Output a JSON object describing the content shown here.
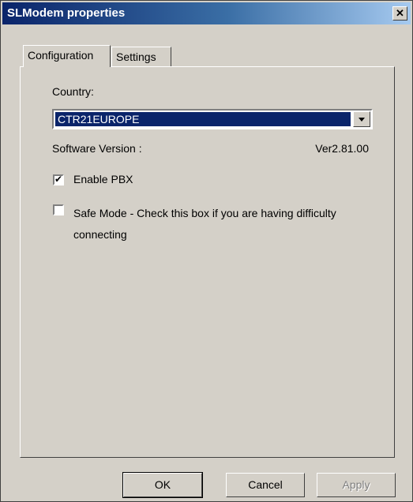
{
  "window": {
    "title": "SLModem properties",
    "close_glyph": "✕"
  },
  "tabs": [
    {
      "label": "Configuration",
      "active": true
    },
    {
      "label": "Settings",
      "active": false
    }
  ],
  "configuration": {
    "country_label": "Country:",
    "country_value": "CTR21EUROPE",
    "software_version_label": "Software Version :",
    "software_version_value": "Ver2.81.00",
    "enable_pbx": {
      "label": "Enable PBX",
      "checked": true
    },
    "safe_mode": {
      "label": "Safe Mode - Check this box if you are having difficulty connecting",
      "checked": false
    }
  },
  "buttons": {
    "ok": "OK",
    "cancel": "Cancel",
    "apply": "Apply"
  },
  "colors": {
    "titlebar_start": "#0a246a",
    "titlebar_end": "#a6caf0",
    "face": "#d4d0c8",
    "selection": "#0a246a"
  }
}
